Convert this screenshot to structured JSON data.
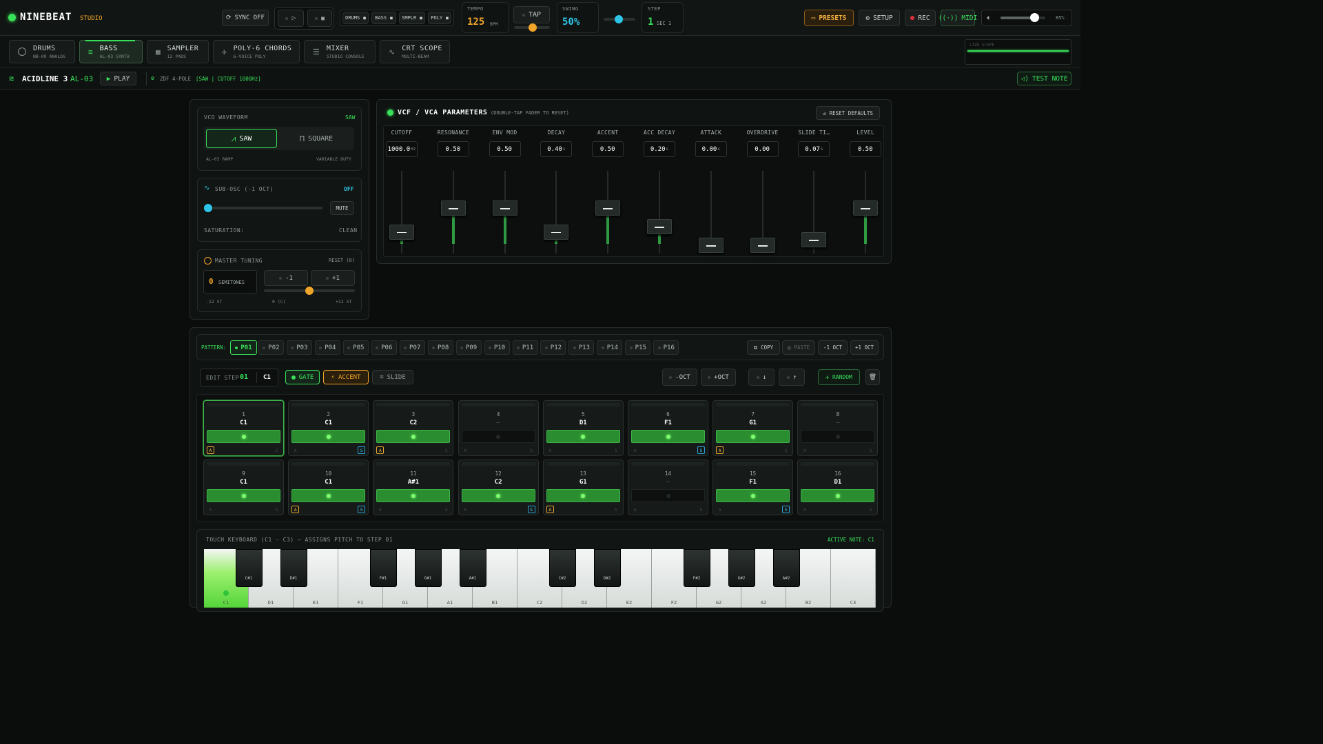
{
  "app": {
    "name": "NINEBEAT",
    "badge": "STUDIO"
  },
  "topbar": {
    "sync": "SYNC OFF",
    "mini_tabs": [
      "DRUMS",
      "BASS",
      "SMPLR",
      "POLY"
    ],
    "tempo_label": "TEMPO",
    "tempo_value": "125",
    "tempo_unit": "BPM",
    "tap": "TAP",
    "swing_label": "SWING",
    "swing_value": "50%",
    "step_label": "STEP",
    "step_value": "1",
    "step_sec": "SEC 1",
    "presets": "PRESETS",
    "setup": "SETUP",
    "rec": "REC",
    "midi": "MIDI",
    "volume": "85%"
  },
  "nav": {
    "tabs": [
      {
        "title": "DRUMS",
        "sub": "NB-09 ANALOG"
      },
      {
        "title": "BASS",
        "sub": "AL-03 SYNTH"
      },
      {
        "title": "SAMPLER",
        "sub": "12 PADS"
      },
      {
        "title": "POLY-6 CHORDS",
        "sub": "6-VOICE POLY"
      },
      {
        "title": "MIXER",
        "sub": "STUDIO CONSOLE"
      },
      {
        "title": "CRT SCOPE",
        "sub": "MULTI-BEAM"
      }
    ],
    "live_scope": "LIVE SCOPE"
  },
  "inst": {
    "name": "ACIDLINE 3",
    "model": "AL-03",
    "play": "PLAY",
    "filter": "ZDF 4-POLE",
    "filter_info": "[SAW | CUTOFF 1000Hz]",
    "test_note": "TEST NOTE"
  },
  "vco": {
    "title": "VCO WAVEFORM",
    "current": "SAW",
    "saw": "SAW",
    "square": "SQUARE",
    "left_note": "AL-03 RAMP",
    "right_note": "VARIABLE DUTY"
  },
  "subosc": {
    "title": "SUB-OSC (-1 OCT)",
    "state": "OFF",
    "mute": "MUTE",
    "saturation_label": "SATURATION:",
    "saturation_value": "CLEAN"
  },
  "tuning": {
    "title": "MASTER TUNING",
    "reset": "RESET (0)",
    "value": "0",
    "unit": "SEMITONES",
    "minus": "-1",
    "plus": "+1",
    "min": "-12 ST",
    "center": "0 (C)",
    "max": "+12 ST"
  },
  "vcf": {
    "title": "VCF / VCA PARAMETERS",
    "hint": "(DOUBLE-TAP FADER TO RESET)",
    "reset": "RESET DEFAULTS",
    "params": [
      {
        "label": "CUTOFF",
        "value": "1000.0",
        "unit": "Hz",
        "level": 0.18
      },
      {
        "label": "RESONANCE",
        "value": "0.50",
        "unit": "",
        "level": 0.5
      },
      {
        "label": "ENV MOD",
        "value": "0.50",
        "unit": "",
        "level": 0.5
      },
      {
        "label": "DECAY",
        "value": "0.40",
        "unit": "s",
        "level": 0.18
      },
      {
        "label": "ACCENT",
        "value": "0.50",
        "unit": "",
        "level": 0.5
      },
      {
        "label": "ACC DECAY",
        "value": "0.20",
        "unit": "s",
        "level": 0.25
      },
      {
        "label": "ATTACK",
        "value": "0.00",
        "unit": "s",
        "level": 0.0
      },
      {
        "label": "OVERDRIVE",
        "value": "0.00",
        "unit": "",
        "level": 0.0
      },
      {
        "label": "SLIDE TI…",
        "value": "0.07",
        "unit": "s",
        "level": 0.07
      },
      {
        "label": "LEVEL",
        "value": "0.50",
        "unit": "",
        "level": 0.5
      }
    ]
  },
  "pattern": {
    "label": "PATTERN:",
    "items": [
      "P01",
      "P02",
      "P03",
      "P04",
      "P05",
      "P06",
      "P07",
      "P08",
      "P09",
      "P10",
      "P11",
      "P12",
      "P13",
      "P14",
      "P15",
      "P16"
    ],
    "copy": "COPY",
    "paste": "PASTE",
    "oct_down": "-1 OCT",
    "oct_up": "+1 OCT"
  },
  "edit": {
    "label": "EDIT STEP",
    "step": "01",
    "note": "C1",
    "gate": "GATE",
    "accent": "ACCENT",
    "slide": "SLIDE",
    "minus_oct": "-OCT",
    "plus_oct": "+OCT",
    "random": "RANDOM"
  },
  "steps": [
    {
      "n": "1",
      "note": "C1",
      "gate": true,
      "accent": true,
      "slide": false
    },
    {
      "n": "2",
      "note": "C1",
      "gate": true,
      "accent": false,
      "slide": true
    },
    {
      "n": "3",
      "note": "C2",
      "gate": true,
      "accent": true,
      "slide": false
    },
    {
      "n": "4",
      "note": "—",
      "gate": false,
      "accent": false,
      "slide": false
    },
    {
      "n": "5",
      "note": "D1",
      "gate": true,
      "accent": false,
      "slide": false
    },
    {
      "n": "6",
      "note": "F1",
      "gate": true,
      "accent": false,
      "slide": true
    },
    {
      "n": "7",
      "note": "G1",
      "gate": true,
      "accent": true,
      "slide": false
    },
    {
      "n": "8",
      "note": "—",
      "gate": false,
      "accent": false,
      "slide": false
    },
    {
      "n": "9",
      "note": "C1",
      "gate": true,
      "accent": false,
      "slide": false
    },
    {
      "n": "10",
      "note": "C1",
      "gate": true,
      "accent": true,
      "slide": true
    },
    {
      "n": "11",
      "note": "A#1",
      "gate": true,
      "accent": false,
      "slide": false
    },
    {
      "n": "12",
      "note": "C2",
      "gate": true,
      "accent": false,
      "slide": true
    },
    {
      "n": "13",
      "note": "G1",
      "gate": true,
      "accent": true,
      "slide": false
    },
    {
      "n": "14",
      "note": "—",
      "gate": false,
      "accent": false,
      "slide": false
    },
    {
      "n": "15",
      "note": "F1",
      "gate": true,
      "accent": false,
      "slide": true
    },
    {
      "n": "16",
      "note": "D1",
      "gate": true,
      "accent": false,
      "slide": false
    }
  ],
  "keyboard": {
    "title": "TOUCH KEYBOARD (C1 - C3) — ASSIGNS PITCH TO STEP 01",
    "active_label": "ACTIVE NOTE:",
    "active_note": "C1",
    "white": [
      "C1",
      "D1",
      "E1",
      "F1",
      "G1",
      "A1",
      "B1",
      "C2",
      "D2",
      "E2",
      "F2",
      "G2",
      "A2",
      "B2",
      "C3"
    ],
    "black": [
      "C#1",
      "D#1",
      "F#1",
      "G#1",
      "A#1",
      "C#2",
      "D#2",
      "F#2",
      "G#2",
      "A#2"
    ]
  },
  "colors": {
    "accent_green": "#39e05a",
    "orange": "#f0a528",
    "cyan": "#2ec6e8"
  }
}
